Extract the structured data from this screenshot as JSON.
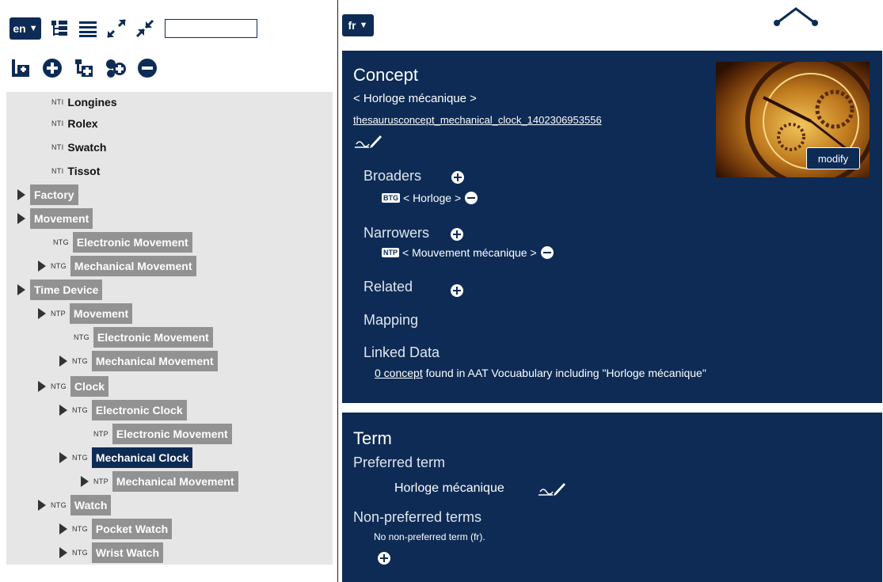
{
  "toolbar": {
    "lang": "en",
    "search_value": ""
  },
  "tree": {
    "nodes": [
      {
        "badge": "NTI",
        "label": "Longines"
      },
      {
        "badge": "NTI",
        "label": "Rolex"
      },
      {
        "badge": "NTI",
        "label": "Swatch"
      },
      {
        "badge": "NTI",
        "label": "Tissot"
      },
      {
        "badge": "",
        "label": "Factory"
      },
      {
        "badge": "",
        "label": "Movement"
      },
      {
        "badge": "NTG",
        "label": "Electronic Movement"
      },
      {
        "badge": "NTG",
        "label": "Mechanical Movement"
      },
      {
        "badge": "",
        "label": "Time Device"
      },
      {
        "badge": "NTP",
        "label": "Movement"
      },
      {
        "badge": "NTG",
        "label": "Electronic Movement"
      },
      {
        "badge": "NTG",
        "label": "Mechanical Movement"
      },
      {
        "badge": "NTG",
        "label": "Clock"
      },
      {
        "badge": "NTG",
        "label": "Electronic Clock"
      },
      {
        "badge": "NTP",
        "label": "Electronic Movement"
      },
      {
        "badge": "NTG",
        "label": "Mechanical Clock"
      },
      {
        "badge": "NTP",
        "label": "Mechanical Movement"
      },
      {
        "badge": "NTG",
        "label": "Watch"
      },
      {
        "badge": "NTG",
        "label": "Pocket Watch"
      },
      {
        "badge": "NTG",
        "label": "Wrist Watch"
      }
    ]
  },
  "right": {
    "lang": "fr"
  },
  "concept": {
    "title": "Concept",
    "name": "< Horloge mécanique >",
    "id_link": "thesaurusconcept_mechanical_clock_1402306953556",
    "modify_label": "modify",
    "broaders_label": "Broaders",
    "broader_badge": "BTG",
    "broader_item": "< Horloge >",
    "narrowers_label": "Narrowers",
    "narrower_badge": "NTP",
    "narrower_item": "< Mouvement mécanique >",
    "related_label": "Related",
    "mapping_label": "Mapping",
    "linked_label": "Linked Data",
    "linked_link": "0 concept",
    "linked_text": " found in AAT Vocuabulary including \"Horloge mécanique\""
  },
  "term": {
    "title": "Term",
    "preferred_label": "Preferred term",
    "preferred_value": "Horloge mécanique",
    "nonpref_label": "Non-preferred terms",
    "nonpref_empty": "No non-preferred term (fr)."
  },
  "colors": {
    "navy": "#0d2b55",
    "gray_node": "#929292",
    "tree_bg": "#e6e6e6"
  }
}
